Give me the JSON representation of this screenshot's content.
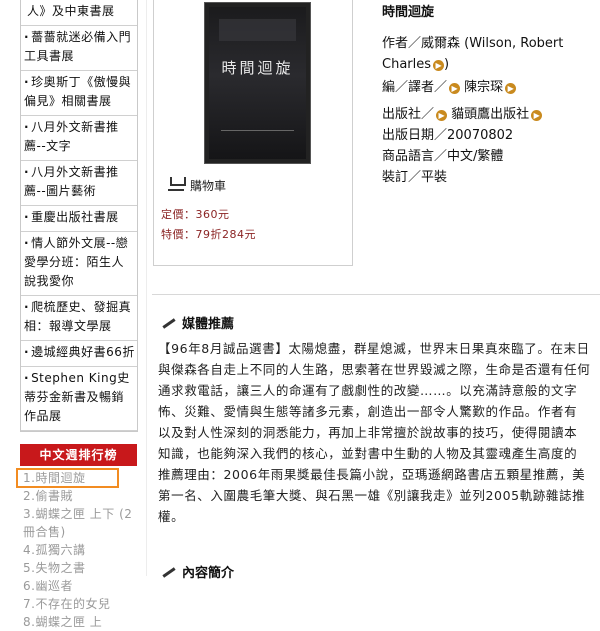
{
  "promo_items": [
    "人》及中東書展",
    "薔薔就迷必備入門工具書展",
    "珍奧斯丁《傲慢與偏見》相關書展",
    "八月外文新書推薦--文字",
    "八月外文新書推薦--圖片藝術",
    "重慶出版社書展",
    "情人節外文展--戀愛學分班：陌生人說我愛你",
    "爬梳歷史、發掘真相：報導文學展",
    "邊城經典好書66折",
    "Stephen King史蒂芬金新書及暢銷作品展"
  ],
  "ranking": {
    "header": "中文週排行榜",
    "items": [
      "1.時間迴旋",
      "2.偷書賊",
      "3.蝴蝶之匣 上下 (2冊合售)",
      "4.孤獨六講",
      "5.失物之書",
      "6.幽巡者",
      "7.不存在的女兒",
      "8.蝴蝶之匣 上"
    ]
  },
  "book": {
    "cover_title": "時間迴旋",
    "cart_label": "購物車",
    "price_label": "定價：360元",
    "sale_label": "特價：79折284元",
    "title": "時間迴旋",
    "author_label": "作者／",
    "author": "威爾森 (Wilson, Robert",
    "author_cont": "Charles",
    "translator_label": "編／譯者／",
    "translator": "陳宗琛",
    "publisher_label": "出版社／",
    "publisher": "貓頭鷹出版社",
    "date_label": "出版日期／",
    "date": "20070802",
    "language_label": "商品語言／",
    "language": "中文/繁體",
    "binding_label": "裝訂／",
    "binding": "平裝"
  },
  "media": {
    "title": "媒體推薦",
    "lines": [
      "【96年8月誠品選書】太陽熄盡，群星熄滅，世界末日果真來臨了。在末日",
      "與傑森各自走上不同的人生路，思索著在世界毀滅之際，生命是否還有任何",
      "通求救電話，讓三人的命運有了戲劇性的改變……。以充滿詩意般的文字",
      "怖、災難、愛情與生態等諸多元素，創造出一部令人驚歎的作品。作者有",
      "以及對人性深刻的洞悉能力，再加上非常擅於說故事的技巧，使得閱讀本",
      "知識，也能夠深入我們的核心，並對書中生動的人物及其靈魂產生高度的",
      "推薦理由：2006年雨果獎最佳長篇小說，亞瑪遜網路書店五顆星推薦，美",
      "第一名、入圍農毛筆大獎、與石黑一雄《別讓我走》並列2005軌跡雜誌推",
      "權。"
    ]
  },
  "intro": {
    "title": "內容簡介"
  },
  "colors": {
    "accent": "#c8181b",
    "highlight": "#f28c21",
    "price": "#8b2424"
  }
}
